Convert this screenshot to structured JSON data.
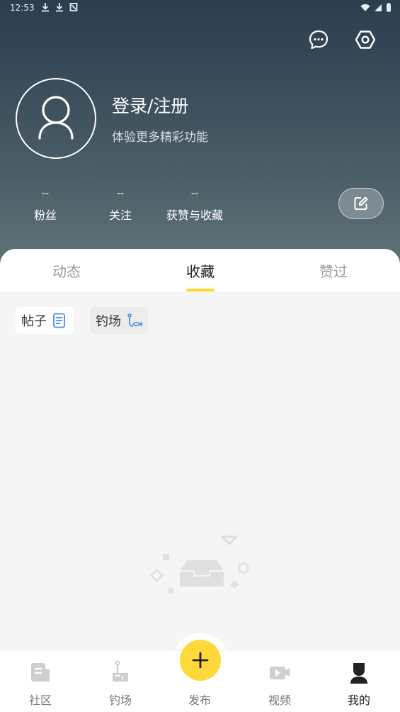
{
  "status_bar": {
    "time": "12:53"
  },
  "header": {
    "login_title": "登录/注册",
    "login_subtitle": "体验更多精彩功能",
    "stats": [
      {
        "value": "--",
        "label": "粉丝"
      },
      {
        "value": "--",
        "label": "关注"
      },
      {
        "value": "--",
        "label": "获赞与收藏"
      }
    ]
  },
  "tabs": [
    {
      "label": "动态",
      "active": false
    },
    {
      "label": "收藏",
      "active": true
    },
    {
      "label": "赞过",
      "active": false
    }
  ],
  "filters": [
    {
      "label": "帖子",
      "icon": "document-icon",
      "selected": true
    },
    {
      "label": "钓场",
      "icon": "fishing-spot-icon",
      "selected": false
    }
  ],
  "bottom_nav": [
    {
      "label": "社区",
      "icon": "community-icon"
    },
    {
      "label": "钓场",
      "icon": "fishing-spot-icon"
    },
    {
      "label": "发布",
      "icon": "plus-icon"
    },
    {
      "label": "视频",
      "icon": "video-icon"
    },
    {
      "label": "我的",
      "icon": "profile-icon",
      "active": true
    }
  ],
  "colors": {
    "accent": "#ffd82a",
    "header_top": "#2b3d4f",
    "header_bottom": "#5f7377",
    "background": "#f5f5f5"
  }
}
